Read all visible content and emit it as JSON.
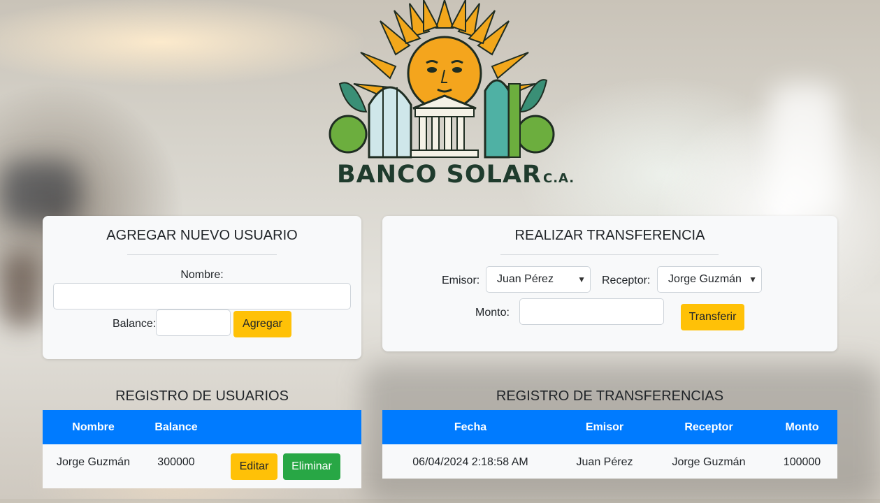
{
  "brand": {
    "name": "BANCO SOLAR",
    "suffix": "C.A."
  },
  "add_user": {
    "title": "AGREGAR NUEVO USUARIO",
    "name_label": "Nombre:",
    "name_value": "",
    "balance_label": "Balance:",
    "balance_value": "",
    "submit_label": "Agregar"
  },
  "transfer": {
    "title": "REALIZAR TRANSFERENCIA",
    "sender_label": "Emisor:",
    "sender_selected": "Juan Pérez",
    "receiver_label": "Receptor:",
    "receiver_selected": "Jorge Guzmán",
    "amount_label": "Monto:",
    "amount_value": "",
    "submit_label": "Transferir"
  },
  "users_registry": {
    "title": "REGISTRO DE USUARIOS",
    "columns": [
      "Nombre",
      "Balance",
      ""
    ],
    "rows": [
      {
        "name": "Jorge Guzmán",
        "balance": "300000",
        "edit_label": "Editar",
        "delete_label": "Eliminar"
      }
    ]
  },
  "transfers_registry": {
    "title": "REGISTRO DE TRANSFERENCIAS",
    "columns": [
      "Fecha",
      "Emisor",
      "Receptor",
      "Monto"
    ],
    "rows": [
      {
        "date": "06/04/2024 2:18:58 AM",
        "sender": "Juan Pérez",
        "receiver": "Jorge Guzmán",
        "amount": "100000"
      }
    ]
  },
  "colors": {
    "table_header": "#007bff",
    "primary_button": "#ffc107",
    "danger_button": "#28a745",
    "card_background": "#f8f9fa"
  },
  "icons": {
    "select_arrow": "chevron-down-icon",
    "logo": "sun-city-logo"
  }
}
